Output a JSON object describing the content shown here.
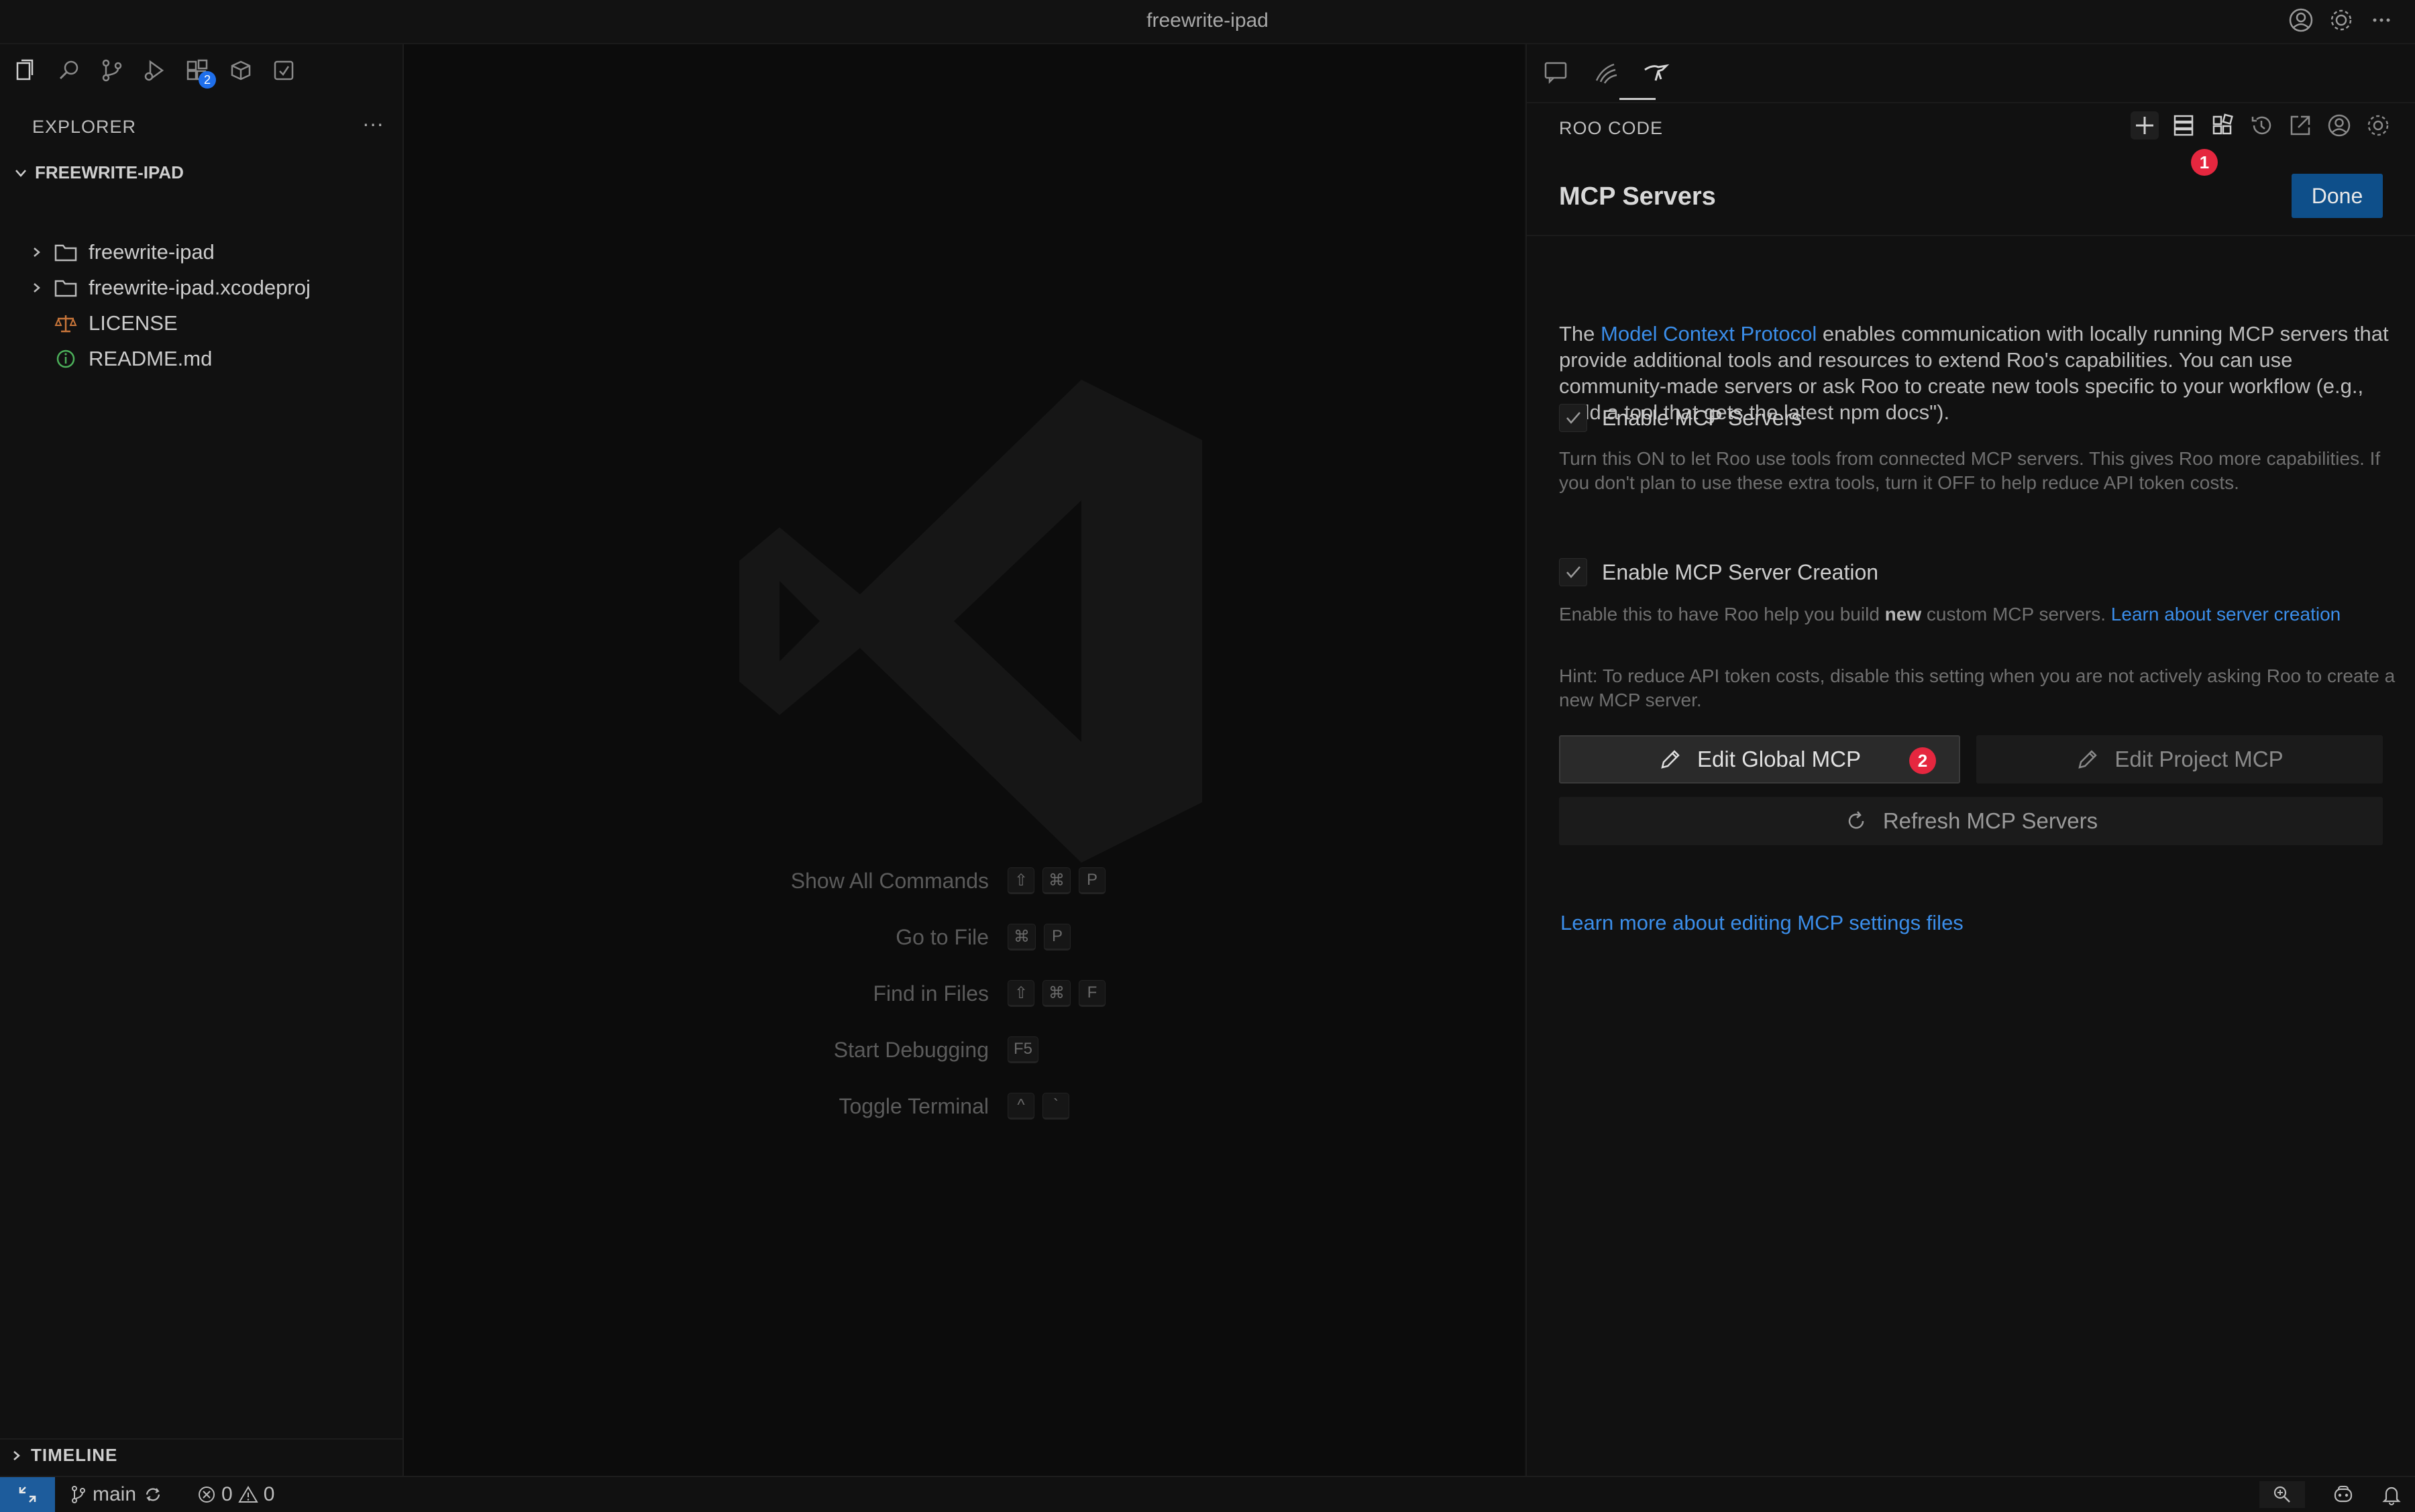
{
  "window": {
    "title": "freewrite-ipad"
  },
  "explorer": {
    "header": "EXPLORER",
    "more": "···",
    "root": "FREEWRITE-IPAD",
    "items": [
      {
        "label": "freewrite-ipad",
        "type": "folder"
      },
      {
        "label": "freewrite-ipad.xcodeproj",
        "type": "folder"
      },
      {
        "label": "LICENSE",
        "type": "license"
      },
      {
        "label": "README.md",
        "type": "info"
      }
    ],
    "extensions_badge": "2",
    "timeline": "TIMELINE"
  },
  "editor": {
    "shortcuts": [
      {
        "label": "Show All Commands",
        "keys": [
          "⇧",
          "⌘",
          "P"
        ]
      },
      {
        "label": "Go to File",
        "keys": [
          "⌘",
          "P"
        ]
      },
      {
        "label": "Find in Files",
        "keys": [
          "⇧",
          "⌘",
          "F"
        ]
      },
      {
        "label": "Start Debugging",
        "keys": [
          "F5"
        ]
      },
      {
        "label": "Toggle Terminal",
        "keys": [
          "^",
          "`"
        ]
      }
    ]
  },
  "roo": {
    "panel_title": "ROO CODE",
    "badge1": "1",
    "mcp_title": "MCP Servers",
    "done_label": "Done",
    "intro_pre": "The ",
    "intro_link": "Model Context Protocol",
    "intro_post": " enables communication with locally running MCP servers that provide additional tools and resources to extend Roo's capabilities. You can use community-made servers or ask Roo to create new tools specific to your workflow (e.g., \"add a tool that gets the latest npm docs\").",
    "enable_servers_label": "Enable MCP Servers",
    "enable_servers_desc": "Turn this ON to let Roo use tools from connected MCP servers. This gives Roo more capabilities. If you don't plan to use these extra tools, turn it OFF to help reduce API token costs.",
    "enable_creation_label": "Enable MCP Server Creation",
    "creation_desc_pre": "Enable this to have Roo help you build ",
    "creation_desc_bold": "new",
    "creation_desc_post": " custom MCP servers. ",
    "creation_link": "Learn about server creation",
    "hint": "Hint: To reduce API token costs, disable this setting when you are not actively asking Roo to create a new MCP server.",
    "edit_global_label": "Edit Global MCP",
    "badge2": "2",
    "edit_project_label": "Edit Project MCP",
    "refresh_label": "Refresh MCP Servers",
    "learn_more": "Learn more about editing MCP settings files"
  },
  "statusbar": {
    "branch": "main",
    "errors": "0",
    "warnings": "0"
  },
  "colors": {
    "accent_link": "#3b8eea",
    "done_button": "#0e4f8a",
    "badge_red": "#e5273f",
    "remote_indicator": "#1d5c9c"
  }
}
